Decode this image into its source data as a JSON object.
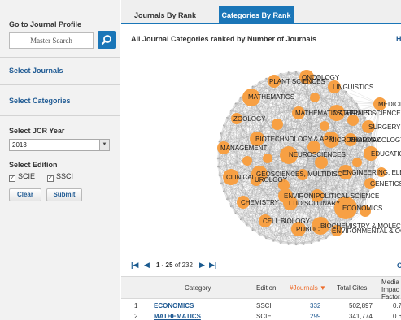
{
  "sidebar": {
    "profile_title": "Go to Journal Profile",
    "search_placeholder": "Master Search",
    "select_journals": "Select Journals",
    "select_categories": "Select Categories",
    "year_label": "Select JCR Year",
    "year_value": "2013",
    "edition_label": "Select Edition",
    "edition_options": [
      "SCIE",
      "SSCI"
    ],
    "clear_label": "Clear",
    "submit_label": "Submit"
  },
  "tabs": [
    "Journals By Rank",
    "Categories By Rank"
  ],
  "active_tab": "Categories By Rank",
  "subtitle": "All Journal Categories ranked by Number of Journals",
  "header_link": "H",
  "network": {
    "node_color": "#f7a044",
    "labels": [
      "PLANT SCIENCES",
      "ONCOLOGY",
      "LINGUISTICS",
      "MATHEMATICS",
      "MEDICINE, GENE",
      "MATHEMATICS, APPLIED",
      "MATERIALS SCIENCE, MULTIDI",
      "ZOOLOGY",
      "SURGERY",
      "BIOTECHNOLOGY & APPL",
      "MICROBIOLOGY",
      "PHARMACOLOGY & PH",
      "MANAGEMENT",
      "NEUROSCIENCES",
      "EDUCATIO",
      "CLINICAL",
      "GEOSCIENCES, MULTIDISC",
      "UROLOGY",
      "ENGINEERING, ELEC",
      "GENETICS",
      "ENVIRONI",
      "POLITICAL SCIENCE",
      "CHEMISTRY",
      "LTIDISCI LINARY",
      "ECONOMICS",
      "CELL BIOLOGY",
      "BIOCHEMISTRY & MOLECU",
      "PUBLIC",
      "ENVIRONMENTAL & OCCUPA"
    ]
  },
  "pager": {
    "range": "1 - 25",
    "of_label": "of 232",
    "right_label": "C"
  },
  "table": {
    "headers": [
      "Category",
      "Edition",
      "#Journals",
      "Total Cites",
      "Media Impac Factor"
    ],
    "sort_indicator": "▼",
    "rows": [
      {
        "rank": "1",
        "category": "ECONOMICS",
        "edition": "SSCI",
        "journals": "332",
        "cites": "502,897",
        "impact": "0.7"
      },
      {
        "rank": "2",
        "category": "MATHEMATICS",
        "edition": "SCIE",
        "journals": "299",
        "cites": "341,774",
        "impact": "0.6"
      }
    ]
  }
}
